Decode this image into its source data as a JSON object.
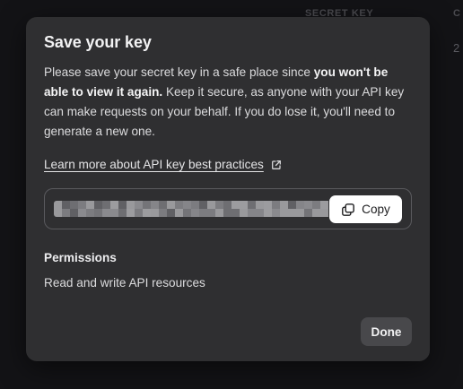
{
  "background": {
    "column_header_1": "SECRET KEY",
    "column_header_2": "C",
    "partial_value": "2"
  },
  "modal": {
    "title": "Save your key",
    "description_part1": "Please save your secret key in a safe place since ",
    "description_bold": "you won't be able to view it again.",
    "description_part2": " Keep it secure, as anyone with your API key can make requests on your behalf. If you do lose it, you'll need to generate a new one.",
    "learn_more_link": "Learn more about API key best practices",
    "key_field": {
      "masked": true
    },
    "copy_button": {
      "label": "Copy",
      "icon": "copy-icon"
    },
    "permissions": {
      "title": "Permissions",
      "value": "Read and write API resources"
    },
    "done_button": {
      "label": "Done"
    }
  },
  "colors": {
    "modal_bg": "#2f2f31",
    "page_bg": "#131316",
    "copy_button_bg": "#ffffff",
    "done_button_bg": "#48484b"
  }
}
